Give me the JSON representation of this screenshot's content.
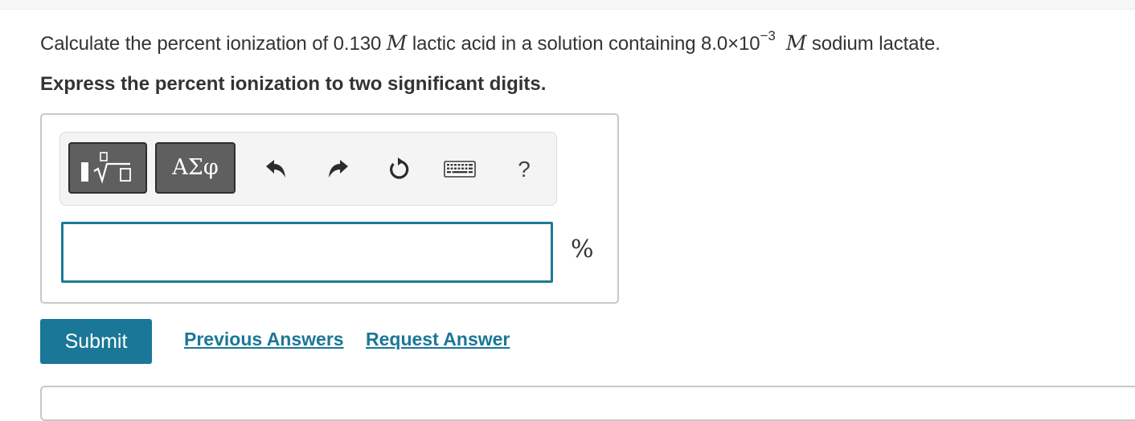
{
  "question": {
    "part1": "Calculate the percent ionization of 0.130 ",
    "molar_symbol_1": "M",
    "part2": " lactic acid in a solution containing 8.0×10",
    "exponent": "−3",
    "molar_symbol_2": "M",
    "part3": " sodium lactate."
  },
  "instruction": "Express the percent ionization to two significant digits.",
  "toolbar": {
    "templates_icon": "templates-sqrt-icon",
    "greek_label": "ΑΣφ",
    "undo_icon": "undo-icon",
    "redo_icon": "redo-icon",
    "reset_icon": "reset-icon",
    "keyboard_icon": "keyboard-icon",
    "help_label": "?"
  },
  "answer": {
    "value": "",
    "unit": "%"
  },
  "actions": {
    "submit_label": "Submit",
    "previous_answers_label": "Previous Answers",
    "request_answer_label": "Request Answer"
  },
  "colors": {
    "accent": "#1b7797",
    "input_border": "#1d7a99",
    "tool_button": "#5f5f5f"
  }
}
